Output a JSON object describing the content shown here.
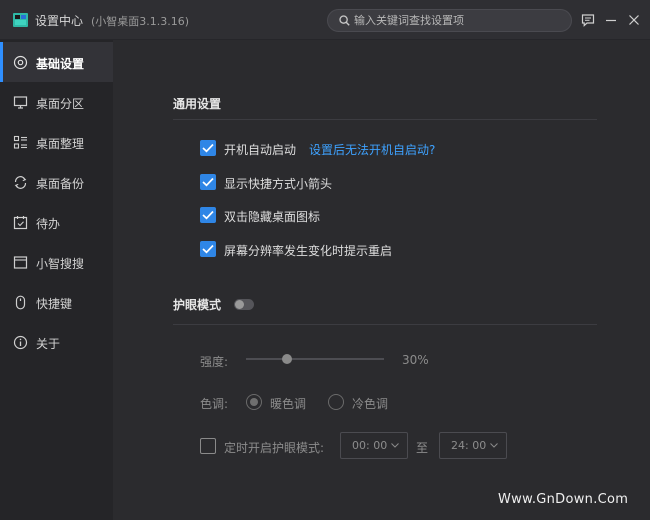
{
  "window": {
    "title": "设置中心",
    "subtitle": "(小智桌面3.1.3.16)"
  },
  "search": {
    "placeholder": "输入关键词查找设置项"
  },
  "sidebar": {
    "items": [
      {
        "label": "基础设置",
        "icon": "gear-icon",
        "active": true
      },
      {
        "label": "桌面分区",
        "icon": "monitor-icon"
      },
      {
        "label": "桌面整理",
        "icon": "grid-list-icon"
      },
      {
        "label": "桌面备份",
        "icon": "backup-icon"
      },
      {
        "label": "待办",
        "icon": "calendar-icon"
      },
      {
        "label": "小智搜搜",
        "icon": "window-icon"
      },
      {
        "label": "快捷键",
        "icon": "mouse-icon"
      },
      {
        "label": "关于",
        "icon": "info-icon"
      }
    ]
  },
  "general": {
    "title": "通用设置",
    "options": [
      {
        "label": "开机自动启动",
        "checked": true
      },
      {
        "label": "显示快捷方式小箭头",
        "checked": true
      },
      {
        "label": "双击隐藏桌面图标",
        "checked": true
      },
      {
        "label": "屏幕分辨率发生变化时提示重启",
        "checked": true
      }
    ],
    "help_link": "设置后无法开机自启动?"
  },
  "eye": {
    "title": "护眼模式",
    "enabled": false,
    "strength_label": "强度:",
    "strength_value": "30%",
    "strength_fraction": 0.3,
    "tone_label": "色调:",
    "tone_warm": "暖色调",
    "tone_cool": "冷色调",
    "tone_selected": "warm",
    "schedule_label": "定时开启护眼模式:",
    "schedule_checked": false,
    "start_time": "00: 00",
    "to_label": "至",
    "end_time": "24: 00"
  },
  "watermark": "Www.GnDown.Com",
  "colors": {
    "accent": "#2f86e6",
    "link": "#3ea2ff",
    "background": "#2b2b2e",
    "sidebar": "#252528"
  }
}
